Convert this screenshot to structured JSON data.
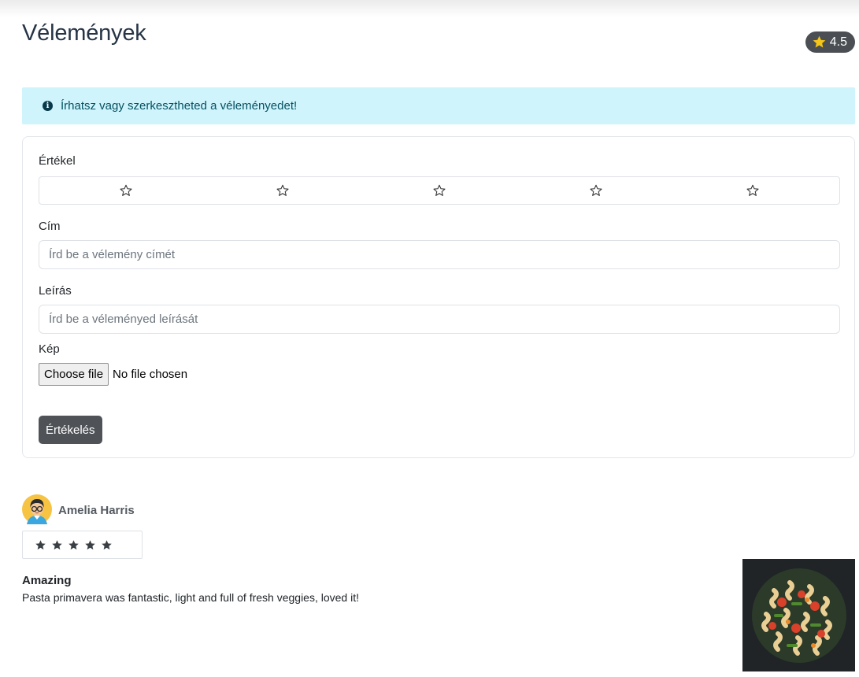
{
  "header": {
    "title": "Vélemények",
    "rating": "4.5"
  },
  "alert": {
    "text": "Írhatsz vagy szerkesztheted a véleményedet!"
  },
  "form": {
    "rating_label": "Értékel",
    "star_count": 5,
    "title_label": "Cím",
    "title_placeholder": "Írd be a vélemény címét",
    "title_value": "",
    "description_label": "Leírás",
    "description_placeholder": "Írd be a véleményed leírását",
    "description_value": "",
    "image_label": "Kép",
    "file_button": "Choose file",
    "file_status": "No file chosen",
    "submit_label": "Értékelés"
  },
  "review": {
    "author": "Amelia Harris",
    "rating": 5,
    "title": "Amazing",
    "text": "Pasta primavera was fantastic, light and full of fresh veggies, loved it!"
  },
  "colors": {
    "heading": "#263445",
    "alert_bg": "#cff4fc",
    "alert_text": "#055160",
    "badge_bg": "#4b4f54",
    "badge_star": "#f5c518",
    "button_bg": "#4f5358"
  }
}
